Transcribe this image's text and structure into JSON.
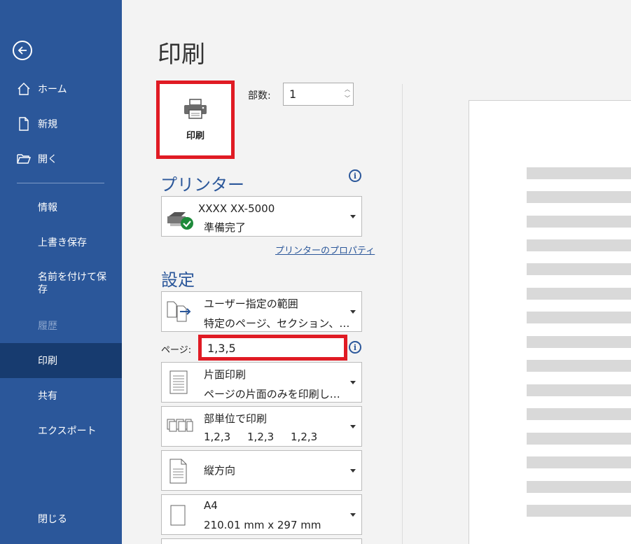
{
  "sidebar": {
    "back_label": "",
    "home": "ホーム",
    "new": "新規",
    "open": "開く",
    "info": "情報",
    "save": "上書き保存",
    "save_as": "名前を付けて保存",
    "history": "履歴",
    "print": "印刷",
    "share": "共有",
    "export": "エクスポート",
    "close": "閉じる"
  },
  "main": {
    "title": "印刷",
    "print_button": "印刷",
    "copies_label": "部数:",
    "copies_value": "1"
  },
  "printer": {
    "heading": "プリンター",
    "name": "XXXX  XX-5000",
    "status": "準備完了",
    "properties_link": "プリンターのプロパティ"
  },
  "settings": {
    "heading": "設定",
    "range_title": "ユーザー指定の範囲",
    "range_sub": "特定のページ、セクション、…",
    "pages_label": "ページ:",
    "pages_value": "1,3,5",
    "sides_title": "片面印刷",
    "sides_sub": "ページの片面のみを印刷し…",
    "collate_title": "部単位で印刷",
    "collate_sub": "1,2,3     1,2,3     1,2,3",
    "orientation_title": "縦方向",
    "paper_title": "A4",
    "paper_sub": "210.01 mm x 297 mm"
  },
  "colors": {
    "sidebar": "#2b579a",
    "sidebar_active": "#173b6f",
    "highlight": "#e01b24"
  }
}
